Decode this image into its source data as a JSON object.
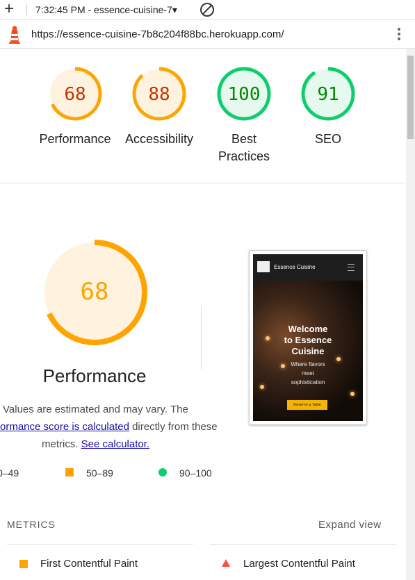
{
  "toolbar": {
    "plus_icon": "plus-icon",
    "tab_title": "7:32:45 PM - essence-cuisine-7▾",
    "block_icon": "block-icon"
  },
  "urlbar": {
    "url": "https://essence-cuisine-7b8c204f88bc.herokuapp.com/",
    "lighthouse_icon": "lighthouse-icon",
    "menu_icon": "kebab-menu-icon"
  },
  "colors": {
    "average": "#ffa400",
    "average_text": "#c33300",
    "average_bg": "#fff3e0",
    "pass": "#0cce6b",
    "pass_text": "#008800",
    "pass_bg": "#e6f9ee",
    "fail": "#ff4e42"
  },
  "gauges": [
    {
      "score": "68",
      "label": "Performance",
      "value": 68,
      "status": "average"
    },
    {
      "score": "88",
      "label": "Accessibility",
      "value": 88,
      "status": "average"
    },
    {
      "score": "100",
      "label": "Best Practices",
      "value": 100,
      "status": "pass"
    },
    {
      "score": "91",
      "label": "SEO",
      "value": 91,
      "status": "pass"
    }
  ],
  "performance": {
    "score": "68",
    "value": 68,
    "title": "Performance",
    "desc_line1": "Values are estimated and may vary. The",
    "desc_link1": "ormance score is calculated",
    "desc_line2_rest": " directly from these",
    "desc_line3": "metrics. ",
    "desc_link2": "See calculator."
  },
  "screenshot": {
    "brand": "Essence Cuisine",
    "heading_line1": "Welcome",
    "heading_line2": "to Essence",
    "heading_line3": "Cuisine",
    "sub_line1": "Where flavors",
    "sub_line2": "meet",
    "sub_line3": "sophistication",
    "button": "Reserve a Table"
  },
  "legend": {
    "fail_range": "0–49",
    "average_range": "50–89",
    "pass_range": "90–100"
  },
  "metrics": {
    "heading": "METRICS",
    "expand": "Expand view",
    "items": [
      {
        "label": "First Contentful Paint",
        "status": "average"
      },
      {
        "label": "Largest Contentful Paint",
        "status": "fail"
      }
    ]
  }
}
